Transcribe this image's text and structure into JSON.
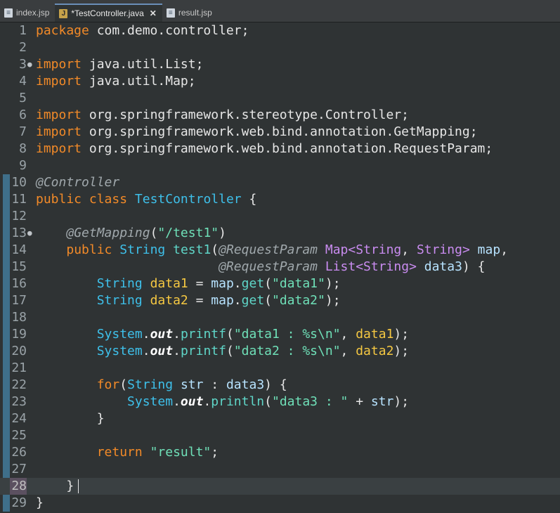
{
  "tabs": [
    {
      "label": "index.jsp",
      "icon": "jsp-file-icon",
      "active": false
    },
    {
      "label": "*TestController.java",
      "icon": "java-file-icon",
      "active": true,
      "close": "✕"
    },
    {
      "label": "result.jsp",
      "icon": "jsp-file-icon",
      "active": false
    }
  ],
  "editor": {
    "current_line": 28,
    "lines": [
      {
        "n": "1",
        "code": "package com.demo.controller;"
      },
      {
        "n": "2",
        "code": ""
      },
      {
        "n": "3",
        "code": "import java.util.List;"
      },
      {
        "n": "4",
        "code": "import java.util.Map;"
      },
      {
        "n": "5",
        "code": ""
      },
      {
        "n": "6",
        "code": "import org.springframework.stereotype.Controller;"
      },
      {
        "n": "7",
        "code": "import org.springframework.web.bind.annotation.GetMapping;"
      },
      {
        "n": "8",
        "code": "import org.springframework.web.bind.annotation.RequestParam;"
      },
      {
        "n": "9",
        "code": ""
      },
      {
        "n": "10",
        "code": "@Controller"
      },
      {
        "n": "11",
        "code": "public class TestController {"
      },
      {
        "n": "12",
        "code": ""
      },
      {
        "n": "13",
        "code": "    @GetMapping(\"/test1\")"
      },
      {
        "n": "14",
        "code": "    public String test1(@RequestParam Map<String, String> map,"
      },
      {
        "n": "15",
        "code": "                        @RequestParam List<String> data3) {"
      },
      {
        "n": "16",
        "code": "        String data1 = map.get(\"data1\");"
      },
      {
        "n": "17",
        "code": "        String data2 = map.get(\"data2\");"
      },
      {
        "n": "18",
        "code": ""
      },
      {
        "n": "19",
        "code": "        System.out.printf(\"data1 : %s\\n\", data1);"
      },
      {
        "n": "20",
        "code": "        System.out.printf(\"data2 : %s\\n\", data2);"
      },
      {
        "n": "21",
        "code": ""
      },
      {
        "n": "22",
        "code": "        for(String str : data3) {"
      },
      {
        "n": "23",
        "code": "            System.out.println(\"data3 : \" + str);"
      },
      {
        "n": "24",
        "code": "        }"
      },
      {
        "n": "25",
        "code": ""
      },
      {
        "n": "26",
        "code": "        return \"result\";"
      },
      {
        "n": "27",
        "code": ""
      },
      {
        "n": "28",
        "code": "    }"
      },
      {
        "n": "29",
        "code": "}"
      }
    ],
    "folded_lines": [
      "3",
      "13"
    ]
  }
}
